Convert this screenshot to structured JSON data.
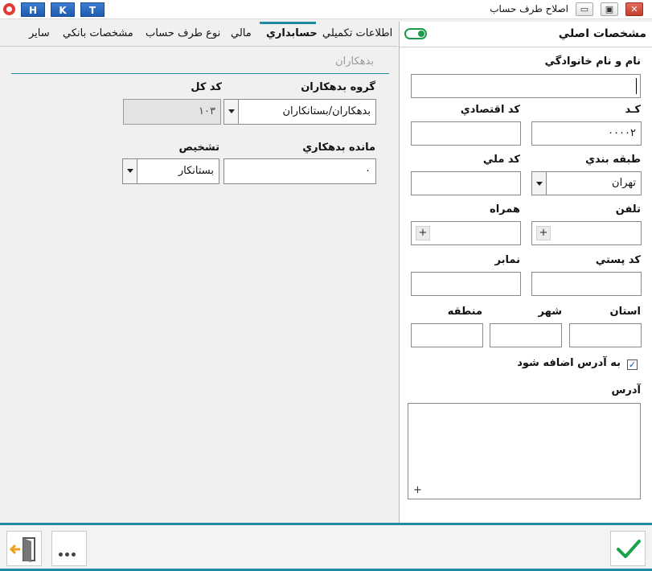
{
  "window": {
    "title": "اصلاح طرف حساب",
    "hotkeys": [
      "H",
      "K",
      "T"
    ],
    "controls": {
      "minimize": "▭",
      "restore": "▣",
      "close": "✕"
    }
  },
  "right_panel": {
    "header": "مشخصات اصلي",
    "toggle_on": true,
    "labels": {
      "name": "نام و نام خانوادگي",
      "code": "کـد",
      "economic_code": "کد اقتصادي",
      "category": "طبقه بندي",
      "national_code": "کد ملي",
      "phone": "تلفن",
      "mobile": "همراه",
      "postal_code": "کد پستي",
      "fax": "نمابر",
      "province": "استان",
      "city": "شهر",
      "region": "منطقه",
      "add_to_address": "به آدرس اضافه شود",
      "address": "آدرس"
    },
    "values": {
      "name": "",
      "code": "۰۰۰۰۲",
      "economic_code": "",
      "category": "تهران",
      "national_code": "",
      "phone": "",
      "mobile": "",
      "postal_code": "",
      "fax": "",
      "province": "",
      "city": "",
      "region": "",
      "add_to_address_checked": true,
      "address": ""
    }
  },
  "left_panel": {
    "tabs": [
      "اطلاعات تکميلي",
      "حسابداري",
      "مالي",
      "نوع طرف حساب",
      "مشخصات بانکي",
      "ساير"
    ],
    "active_tab": "حسابداري",
    "section_title": "بدهکاران",
    "labels": {
      "debtor_group": "گروه بدهکاران",
      "ledger_code": "کد کل",
      "debtor_balance": "مانده بدهکاري",
      "detection": "تشخيص"
    },
    "values": {
      "debtor_group": "بدهکاران/بستانکاران",
      "ledger_code": "۱۰۳",
      "debtor_balance": "۰",
      "detection": "بستانکار"
    }
  },
  "footer": {
    "more_glyph": "•••",
    "exit_icon": "exit-icon",
    "confirm_icon": "check-icon"
  },
  "colors": {
    "accent": "#1f8aa0",
    "hotkey_blue": "#2b6cc4",
    "toggle_green": "#1c9a4a",
    "confirm_green": "#1aa34a",
    "exit_orange": "#f0a020"
  }
}
